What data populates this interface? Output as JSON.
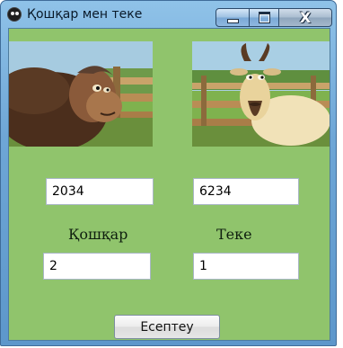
{
  "window": {
    "title": "Қошқар мен теке",
    "close_symbol": "X"
  },
  "inputs": {
    "top_left": "2034",
    "top_right": "6234",
    "bottom_left": "2",
    "bottom_right": "1"
  },
  "labels": {
    "ram": "Қошқар",
    "goat": "Теке"
  },
  "buttons": {
    "calculate": "Есептеу"
  },
  "icons": {
    "app": "app-icon",
    "minimize": "minimize-icon",
    "maximize": "maximize-icon",
    "close": "close-icon"
  },
  "colors": {
    "client_background": "#90c46c",
    "titlebar": "#6ea6d6"
  }
}
